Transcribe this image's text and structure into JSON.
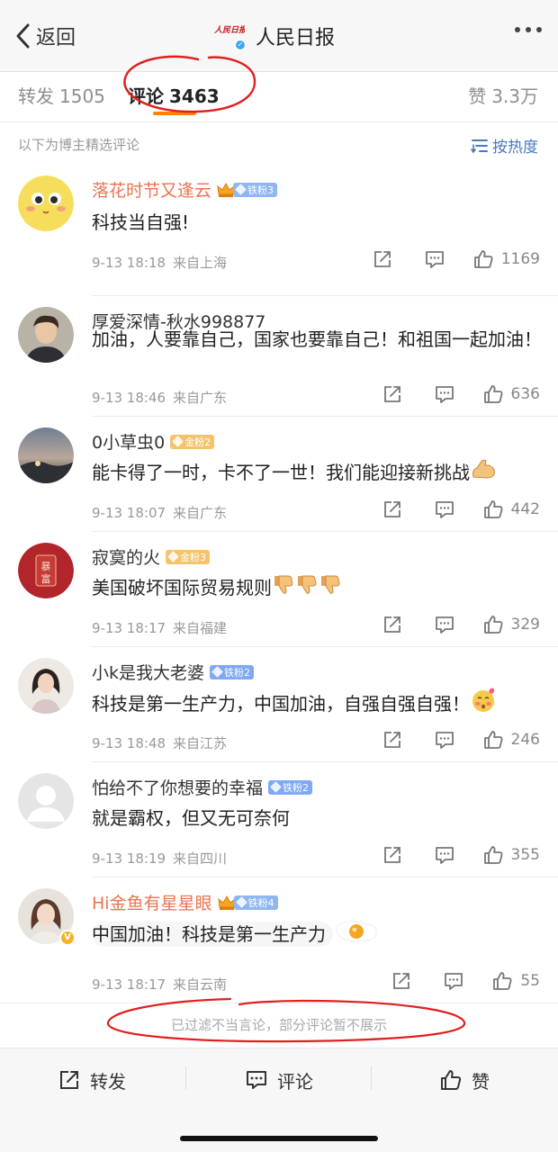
{
  "nav": {
    "back_label": "返回",
    "title": "人民日报",
    "logo_text": "人民日报"
  },
  "tabs": {
    "repost": {
      "label": "转发",
      "count": "1505"
    },
    "comment": {
      "label": "评论",
      "count": "3463"
    },
    "like": {
      "label": "赞",
      "count": "3.3万"
    }
  },
  "sort": {
    "note": "以下为博主精选评论",
    "label": "按热度"
  },
  "colors": {
    "accent": "#ff8200",
    "annotation_red": "#e02020",
    "link_blue": "#4a78c0",
    "vip_orange": "#eb7350"
  },
  "comments": [
    {
      "name": "落花时节又逢云",
      "vip": true,
      "crown": true,
      "badge": "铁粉3",
      "badge_type": "iron",
      "text": "科技当自强!",
      "date": "9-13 18:18",
      "source": "来自上海",
      "likes": "1169"
    },
    {
      "name": "厚爱深情-秋水998877",
      "vip": false,
      "crown": false,
      "badge": "",
      "badge_type": "",
      "text": "加油，人要靠自己，国家也要靠自己！和祖国一起加油！",
      "date": "9-13 18:46",
      "source": "来自广东",
      "likes": "636"
    },
    {
      "name": "0小草虫0",
      "vip": false,
      "crown": false,
      "badge": "金粉2",
      "badge_type": "gold",
      "text": "能卡得了一时，卡不了一世！我们能迎接新挑战",
      "emoji": "muscle-emoji",
      "date": "9-13 18:07",
      "source": "来自广东",
      "likes": "442"
    },
    {
      "name": "寂寞的火",
      "vip": false,
      "crown": false,
      "badge": "金粉3",
      "badge_type": "gold",
      "text": "美国破坏国际贸易规则",
      "emoji": "thumbs-down-emoji",
      "date": "9-13 18:17",
      "source": "来自福建",
      "likes": "329"
    },
    {
      "name": "小k是我大老婆",
      "vip": false,
      "crown": false,
      "badge": "铁粉2",
      "badge_type": "diamond",
      "text": "科技是第一生产力，中国加油，自强自强自强！",
      "emoji": "blushing-face-emoji",
      "date": "9-13 18:48",
      "source": "来自江苏",
      "likes": "246"
    },
    {
      "name": "怕给不了你想要的幸福",
      "vip": false,
      "crown": false,
      "badge": "铁粉2",
      "badge_type": "diamond",
      "text": "就是霸权，但又无可奈何",
      "date": "9-13 18:19",
      "source": "来自四川",
      "likes": "355"
    },
    {
      "name": "Hi金鱼有星星眼",
      "vip": true,
      "crown": true,
      "badge": "铁粉4",
      "badge_type": "iron",
      "text": "中国加油！科技是第一生产力",
      "emoji": "fried-egg-emoji",
      "date": "9-13 18:17",
      "source": "来自云南",
      "likes": "55"
    }
  ],
  "avatar_badge": "V",
  "footer_note": "已过滤不当言论，部分评论暂不展示",
  "bottom_bar": {
    "repost": "转发",
    "comment": "评论",
    "like": "赞"
  }
}
